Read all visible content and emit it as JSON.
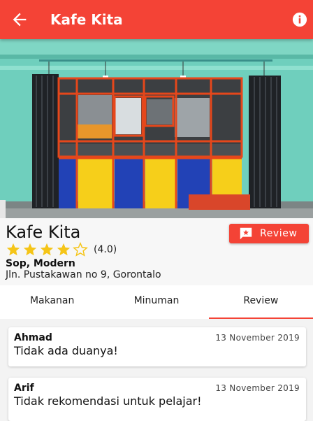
{
  "appbar": {
    "title": "Kafe Kita",
    "back_icon": "arrow-back-icon",
    "info_icon": "info-icon"
  },
  "colors": {
    "primary": "#f44336",
    "star": "#f5c518"
  },
  "place": {
    "name": "Kafe Kita",
    "rating": 4.0,
    "rating_text": "(4.0)",
    "max_rating": 5,
    "category": "Sop, Modern",
    "address": "Jln. Pustakawan no 9, Gorontalo"
  },
  "review_button": {
    "label": "Review",
    "icon": "rate-review-icon"
  },
  "tabs": [
    {
      "label": "Makanan",
      "active": false
    },
    {
      "label": "Minuman",
      "active": false
    },
    {
      "label": "Review",
      "active": true
    }
  ],
  "reviews": [
    {
      "author": "Ahmad",
      "date": "13 November 2019",
      "comment": "Tidak ada duanya!"
    },
    {
      "author": "Arif",
      "date": "13 November 2019",
      "comment": "Tidak rekomendasi untuk pelajar!"
    }
  ]
}
